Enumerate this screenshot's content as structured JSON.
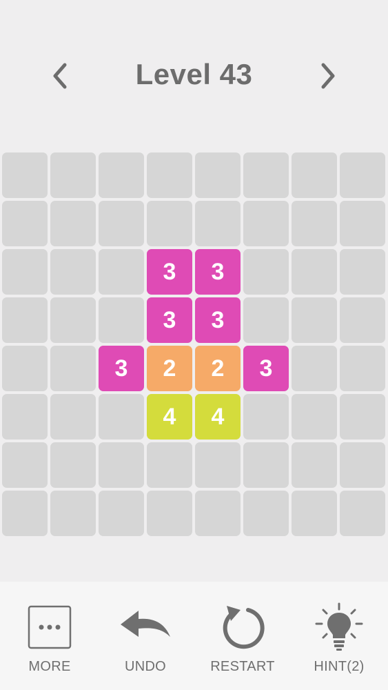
{
  "header": {
    "title": "Level 43",
    "prev_icon": "chevron-left-icon",
    "next_icon": "chevron-right-icon"
  },
  "board": {
    "rows": 8,
    "cols": 8,
    "empty_color": "#d6d6d6",
    "tiles": [
      {
        "row": 2,
        "col": 3,
        "value": "3",
        "color": "#df4bb5"
      },
      {
        "row": 2,
        "col": 4,
        "value": "3",
        "color": "#df4bb5"
      },
      {
        "row": 3,
        "col": 3,
        "value": "3",
        "color": "#df4bb5"
      },
      {
        "row": 3,
        "col": 4,
        "value": "3",
        "color": "#df4bb5"
      },
      {
        "row": 4,
        "col": 2,
        "value": "3",
        "color": "#df4bb5"
      },
      {
        "row": 4,
        "col": 3,
        "value": "2",
        "color": "#f6aa68"
      },
      {
        "row": 4,
        "col": 4,
        "value": "2",
        "color": "#f6aa68"
      },
      {
        "row": 4,
        "col": 5,
        "value": "3",
        "color": "#df4bb5"
      },
      {
        "row": 5,
        "col": 3,
        "value": "4",
        "color": "#d4dc3c"
      },
      {
        "row": 5,
        "col": 4,
        "value": "4",
        "color": "#d4dc3c"
      }
    ]
  },
  "toolbar": {
    "more_label": "MORE",
    "undo_label": "UNDO",
    "restart_label": "RESTART",
    "hint_label": "HINT(2)",
    "icons": [
      "more-icon",
      "undo-icon",
      "restart-icon",
      "hint-bulb-icon"
    ]
  }
}
